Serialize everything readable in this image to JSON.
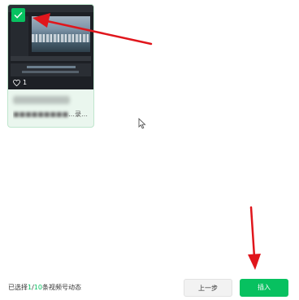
{
  "video_card": {
    "likes_count": "1",
    "description": "…录…",
    "selected": true
  },
  "footer": {
    "selection_prefix": "已选择",
    "selected_count": "1",
    "separator": "/",
    "max_count": "10",
    "selection_suffix": "条视频号动态"
  },
  "buttons": {
    "prev_label": "上一步",
    "insert_label": "插入"
  },
  "colors": {
    "accent": "#07c160",
    "annotation_arrow": "#e0161c"
  }
}
